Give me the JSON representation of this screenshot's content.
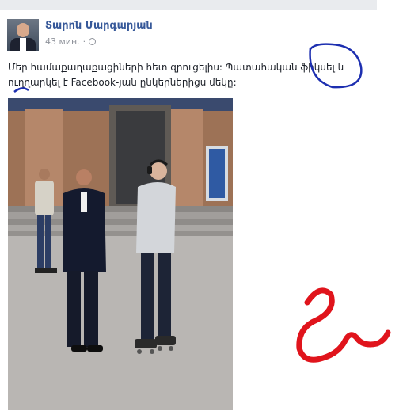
{
  "post": {
    "author": "Տարոն Մարգարյան",
    "time": "43 мин.",
    "separator": "·",
    "caption": "Մեր համաքաղաքացիների հետ զրուցելիս: Պատահական ֆիկսել և ուղղարկել է Facebook-յան ընկերներիցս մեկը:"
  },
  "icons": {
    "globe": "globe-icon"
  },
  "colors": {
    "author_link": "#365899",
    "annotation_blue": "#1d2fb0",
    "annotation_red": "#e0141c"
  }
}
